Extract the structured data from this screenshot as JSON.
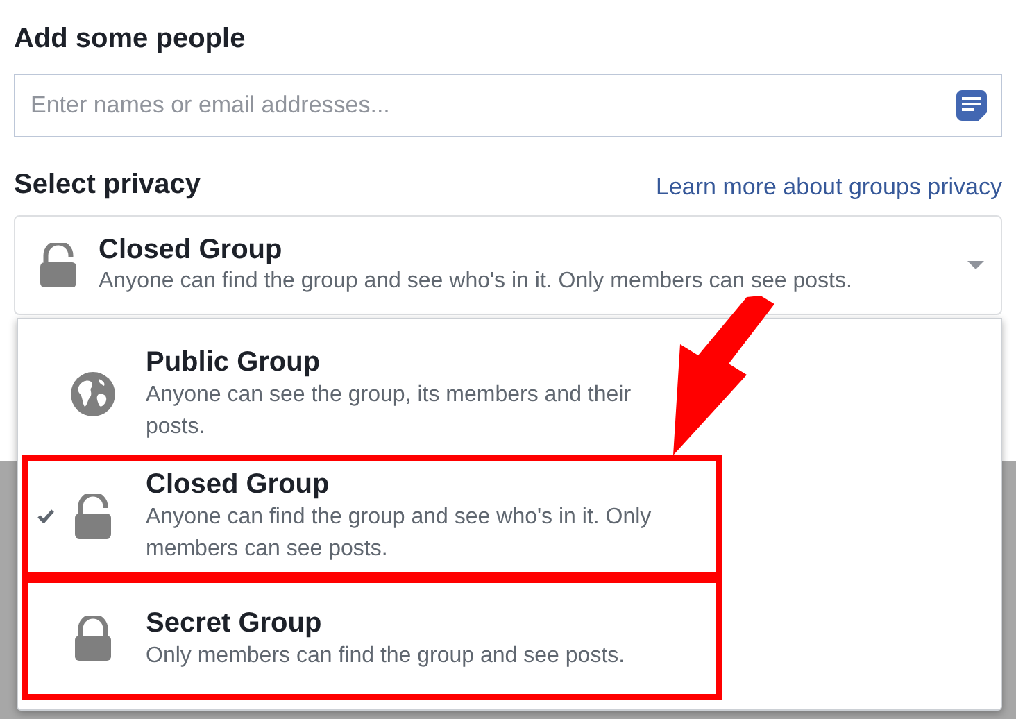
{
  "people": {
    "heading": "Add some people",
    "placeholder": "Enter names or email addresses..."
  },
  "privacy": {
    "heading": "Select privacy",
    "link": "Learn more about groups privacy",
    "current": {
      "kind": "closed",
      "title": "Closed Group",
      "description": "Anyone can find the group and see who's in it. Only members can see posts."
    },
    "options": [
      {
        "kind": "public",
        "title": "Public Group",
        "description": "Anyone can see the group, its members and their posts.",
        "selected": false,
        "highlighted": false
      },
      {
        "kind": "closed",
        "title": "Closed Group",
        "description": "Anyone can find the group and see who's in it. Only members can see posts.",
        "selected": true,
        "highlighted": true
      },
      {
        "kind": "secret",
        "title": "Secret Group",
        "description": "Only members can find the group and see posts.",
        "selected": false,
        "highlighted": true
      }
    ]
  }
}
